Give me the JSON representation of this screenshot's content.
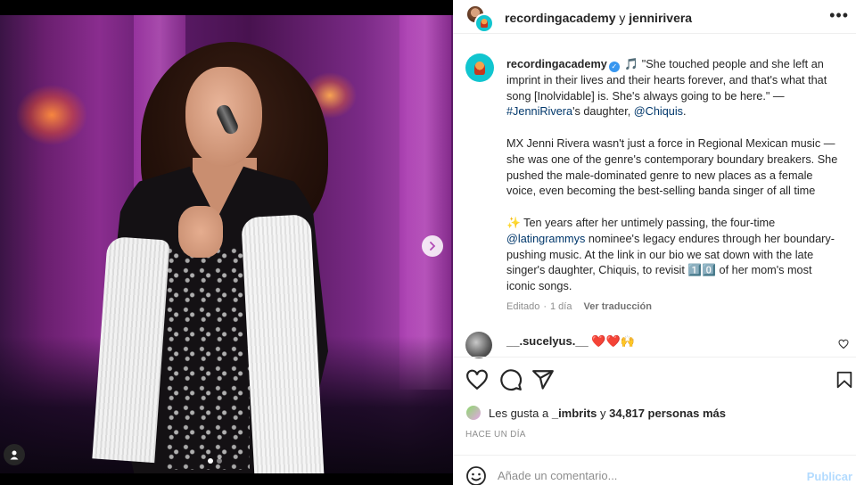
{
  "header": {
    "user1": "recordingacademy",
    "joiner": "y",
    "user2": "jennirivera",
    "more_icon": "more-horizontal-icon"
  },
  "caption": {
    "username": "recordingacademy",
    "line1": "\"She touched people and she left an imprint in their lives and their hearts forever, and that's what that song [Inolvidable] is. She's always going to be here.\" —",
    "hashtag": "#JenniRivera",
    "line1b": "'s daughter,",
    "mention1": "@Chiquis",
    "line1c": ".",
    "para2": "MX Jenni Rivera wasn't just a force in Regional Mexican music — she was one of the genre's contemporary boundary breakers. She pushed the male-dominated genre to new places as a female voice, even becoming the best-selling banda singer of all time",
    "para3_emoji": "✨",
    "para3a": "Ten years after her untimely passing, the four-time",
    "mention2": "@latingrammys",
    "para3b": "nominee's legacy endures through her boundary-pushing music. At the link in our bio we sat down with the late singer's daughter, Chiquis, to revisit 1️⃣0️⃣ of her mom's most iconic songs.",
    "edited": "Editado",
    "age": "1 día",
    "translate": "Ver traducción"
  },
  "comment": {
    "username": "__.sucelyus.__",
    "text": "❤️❤️🙌"
  },
  "likes": {
    "prefix": "Les gusta a",
    "user": "_imbrits",
    "middle": "y",
    "count": "34,817 personas más"
  },
  "timestamp": "HACE UN DÍA",
  "composer": {
    "placeholder": "Añade un comentario...",
    "publish": "Publicar"
  },
  "carousel": {
    "slides": 2,
    "active_index": 0
  },
  "colors": {
    "link": "#00376b",
    "verified": "#3897f0",
    "publish_disabled": "#b3dbff",
    "avatar_brand": "#11c5cf"
  }
}
